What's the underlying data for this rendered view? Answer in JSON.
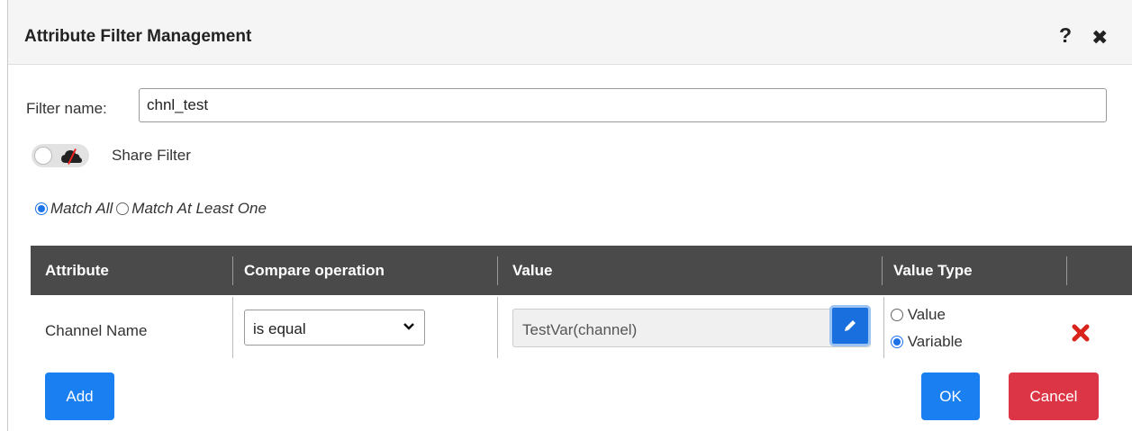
{
  "dialog": {
    "title": "Attribute Filter Management",
    "help_icon": "?",
    "close_icon": "✖"
  },
  "filter": {
    "label": "Filter name:",
    "value": "chnl_test"
  },
  "share": {
    "label": "Share Filter",
    "toggle_on": false,
    "icon": "cloud-slash-icon"
  },
  "match": {
    "options": [
      "Match All",
      "Match At Least One"
    ],
    "selected": "Match All"
  },
  "table": {
    "headers": [
      "Attribute",
      "Compare operation",
      "Value",
      "Value Type"
    ],
    "rows": [
      {
        "attribute": "Channel Name",
        "operation": "is equal",
        "value": "TestVar(channel)",
        "value_type_options": [
          "Value",
          "Variable"
        ],
        "value_type_selected": "Variable"
      }
    ]
  },
  "buttons": {
    "add": "Add",
    "ok": "OK",
    "cancel": "Cancel"
  },
  "colors": {
    "primary": "#1a7ff0",
    "danger": "#dc3545",
    "table_header": "#4a4a4a",
    "delete_icon": "#d9241c"
  }
}
